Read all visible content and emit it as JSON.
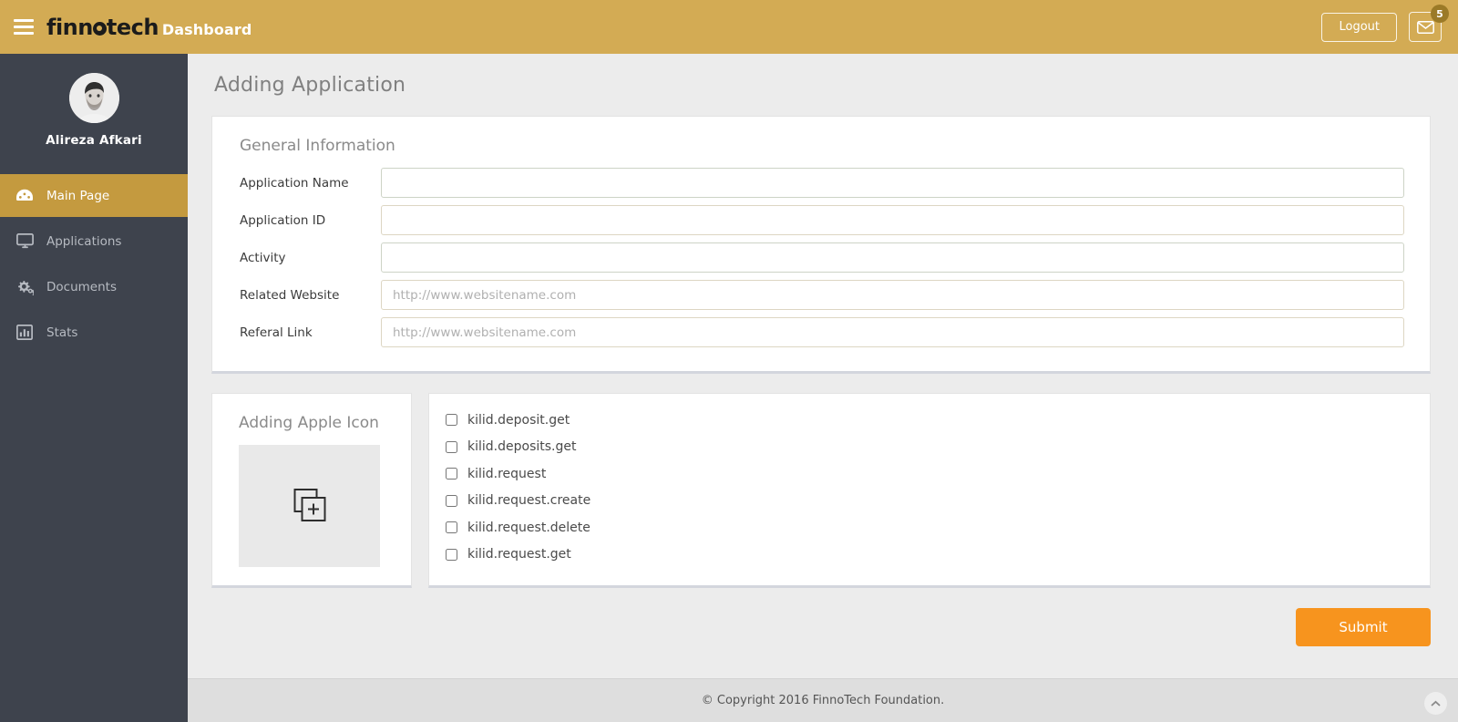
{
  "header": {
    "menu_icon": "hamburger-icon",
    "brand_part1": "finn",
    "brand_part2": "tech",
    "brand_sub": "Dashboard",
    "logout_label": "Logout",
    "mail_icon": "envelope-icon",
    "mail_badge": "5",
    "bg_color": "#d3ab54"
  },
  "sidebar": {
    "avatar_name": "avatar",
    "username": "Alireza Afkari",
    "bg_color": "#3e434d",
    "active_color": "#c49a3f",
    "items": [
      {
        "label": "Main Page",
        "icon": "dashboard-gauge-icon",
        "active": true
      },
      {
        "label": "Applications",
        "icon": "monitor-icon",
        "active": false
      },
      {
        "label": "Documents",
        "icon": "gears-icon",
        "active": false
      },
      {
        "label": "Stats",
        "icon": "bar-chart-icon",
        "active": false
      }
    ]
  },
  "main": {
    "page_title": "Adding Application",
    "general": {
      "section_title": "General Information",
      "fields": [
        {
          "label": "Application Name",
          "value": "",
          "placeholder": ""
        },
        {
          "label": "Application  ID",
          "value": "",
          "placeholder": ""
        },
        {
          "label": "Activity",
          "value": "",
          "placeholder": ""
        },
        {
          "label": "Related Website",
          "value": "",
          "placeholder": "http://www.websitename.com"
        },
        {
          "label": "Referal Link",
          "value": "",
          "placeholder": "http://www.websitename.com"
        }
      ]
    },
    "apple_icon": {
      "section_title": "Adding Apple Icon",
      "upload_icon": "add-image-icon"
    },
    "scopes": [
      {
        "label": "kilid.deposit.get",
        "checked": false
      },
      {
        "label": "kilid.deposits.get",
        "checked": false
      },
      {
        "label": "kilid.request",
        "checked": false
      },
      {
        "label": "kilid.request.create",
        "checked": false
      },
      {
        "label": "kilid.request.delete",
        "checked": false
      },
      {
        "label": "kilid.request.get",
        "checked": false
      }
    ],
    "submit_label": "Submit",
    "submit_color": "#f7941e"
  },
  "footer": {
    "copyright": "© Copyright 2016 FinnoTech Foundation.",
    "scroll_top_icon": "chevron-up-icon"
  }
}
